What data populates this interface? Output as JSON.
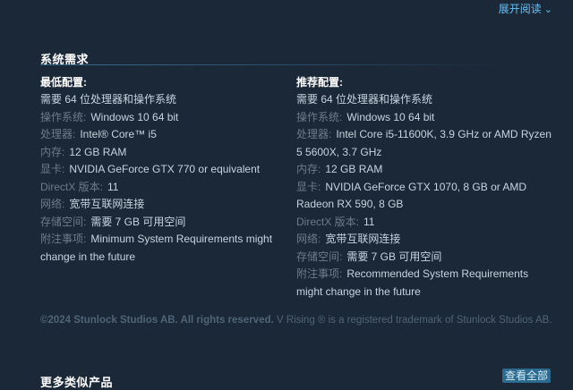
{
  "header": {
    "expand_label": "展开阅读",
    "expand_icon": "chevron-down-icon"
  },
  "requirements": {
    "title": "系统需求",
    "minimum": {
      "heading": "最低配置:",
      "note": "需要 64 位处理器和操作系统",
      "rows": [
        {
          "label": "操作系统:",
          "value": "Windows 10 64 bit"
        },
        {
          "label": "处理器:",
          "value": "Intel® Core™ i5"
        },
        {
          "label": "内存:",
          "value": "12 GB RAM"
        },
        {
          "label": "显卡:",
          "value": "NVIDIA GeForce GTX 770 or equivalent"
        },
        {
          "label": "DirectX 版本:",
          "value": "11"
        },
        {
          "label": "网络:",
          "value": "宽带互联网连接"
        },
        {
          "label": "存储空间:",
          "value": "需要 7 GB 可用空间"
        },
        {
          "label": "附注事项:",
          "value": "Minimum System Requirements might change in the future"
        }
      ]
    },
    "recommended": {
      "heading": "推荐配置:",
      "note": "需要 64 位处理器和操作系统",
      "rows": [
        {
          "label": "操作系统:",
          "value": "Windows 10 64 bit"
        },
        {
          "label": "处理器:",
          "value": "Intel Core i5-11600K, 3.9 GHz or AMD Ryzen 5 5600X, 3.7 GHz"
        },
        {
          "label": "内存:",
          "value": "12 GB RAM"
        },
        {
          "label": "显卡:",
          "value": "NVIDIA GeForce GTX 1070, 8 GB or AMD Radeon RX 590, 8 GB"
        },
        {
          "label": "DirectX 版本:",
          "value": "11"
        },
        {
          "label": "网络:",
          "value": "宽带互联网连接"
        },
        {
          "label": "存储空间:",
          "value": "需要 7 GB 可用空间"
        },
        {
          "label": "附注事项:",
          "value": "Recommended System Requirements might change in the future"
        }
      ]
    }
  },
  "footer": {
    "copyright_bold": "©2024 Stunlock Studios AB. All rights reserved.",
    "trademark": "V Rising ® is a registered trademark of Stunlock Studios AB."
  },
  "more_section": {
    "title": "更多类似产品",
    "view_all_label": "查看全部"
  },
  "colors": {
    "background": "#1b2838",
    "link": "#67c1f5",
    "label": "#6b7c88",
    "value": "#c6d4df",
    "button": "#2c6b8d"
  }
}
